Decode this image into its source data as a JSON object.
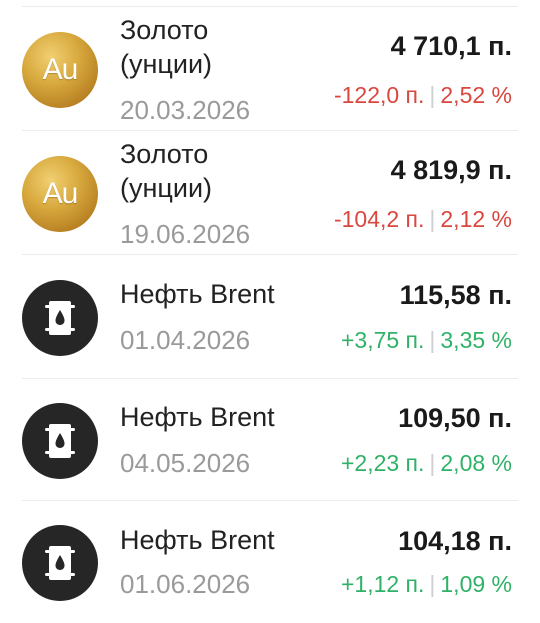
{
  "instruments": [
    {
      "name_line1": "Золото",
      "name_line2": "(унции)",
      "date": "20.03.2026",
      "icon": "gold-au-icon",
      "icon_text": "Au",
      "price": "4 710,1 п.",
      "change_abs": "-122,0 п.",
      "change_pct": "2,52 %",
      "direction": "down"
    },
    {
      "name_line1": "Золото",
      "name_line2": "(унции)",
      "date": "19.06.2026",
      "icon": "gold-au-icon",
      "icon_text": "Au",
      "price": "4 819,9 п.",
      "change_abs": "-104,2 п.",
      "change_pct": "2,12 %",
      "direction": "down"
    },
    {
      "name_line1": "Нефть Brent",
      "date": "01.04.2026",
      "icon": "oil-barrel-icon",
      "price": "115,58 п.",
      "change_abs": "+3,75 п.",
      "change_pct": "3,35 %",
      "direction": "up"
    },
    {
      "name_line1": "Нефть Brent",
      "date": "04.05.2026",
      "icon": "oil-barrel-icon",
      "price": "109,50 п.",
      "change_abs": "+2,23 п.",
      "change_pct": "2,08 %",
      "direction": "up"
    },
    {
      "name_line1": "Нефть Brent",
      "date": "01.06.2026",
      "icon": "oil-barrel-icon",
      "price": "104,18 п.",
      "change_abs": "+1,12 п.",
      "change_pct": "1,09 %",
      "direction": "up"
    }
  ],
  "separator": "|",
  "colors": {
    "negative": "#d9473f",
    "positive": "#2fb267",
    "gold": "#d8a93e",
    "oil_icon_bg": "#262626"
  }
}
